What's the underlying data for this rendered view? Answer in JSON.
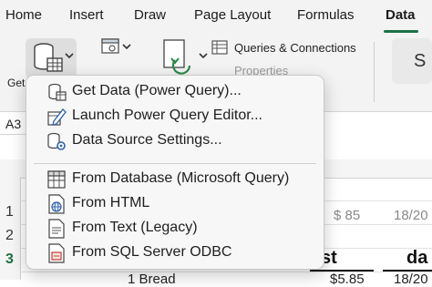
{
  "ribbon": {
    "tabs": [
      {
        "label": "Home"
      },
      {
        "label": "Insert"
      },
      {
        "label": "Draw"
      },
      {
        "label": "Page Layout"
      },
      {
        "label": "Formulas"
      },
      {
        "label": "Data"
      }
    ],
    "active_tab": "Data",
    "get_data_label_partial": "Get",
    "queries_connections_label": "Queries & Connections",
    "properties_label": "Properties",
    "accent_color": "#1e7145"
  },
  "name_box": {
    "value": "A3"
  },
  "grid": {
    "row_numbers": [
      "1",
      "2",
      "3"
    ],
    "selected_row": "3",
    "visible_cells": [
      {
        "text": "$ 85"
      },
      {
        "text": "18/20"
      },
      {
        "text": "st"
      },
      {
        "text": "da"
      },
      {
        "text": "1 Bread"
      },
      {
        "text": "$5.85"
      },
      {
        "text": "18/20"
      }
    ]
  },
  "menu": {
    "items_top": [
      {
        "label": "Get Data (Power Query)...",
        "icon": "get-data-icon"
      },
      {
        "label": "Launch Power Query Editor...",
        "icon": "edit-pencil-icon"
      },
      {
        "label": "Data Source Settings...",
        "icon": "data-source-gear-icon"
      }
    ],
    "items_bottom": [
      {
        "label": "From Database (Microsoft Query)",
        "icon": "database-table-icon"
      },
      {
        "label": "From HTML",
        "icon": "globe-page-icon"
      },
      {
        "label": "From Text (Legacy)",
        "icon": "text-file-icon"
      },
      {
        "label": "From SQL Server ODBC",
        "icon": "sql-file-icon"
      }
    ]
  }
}
